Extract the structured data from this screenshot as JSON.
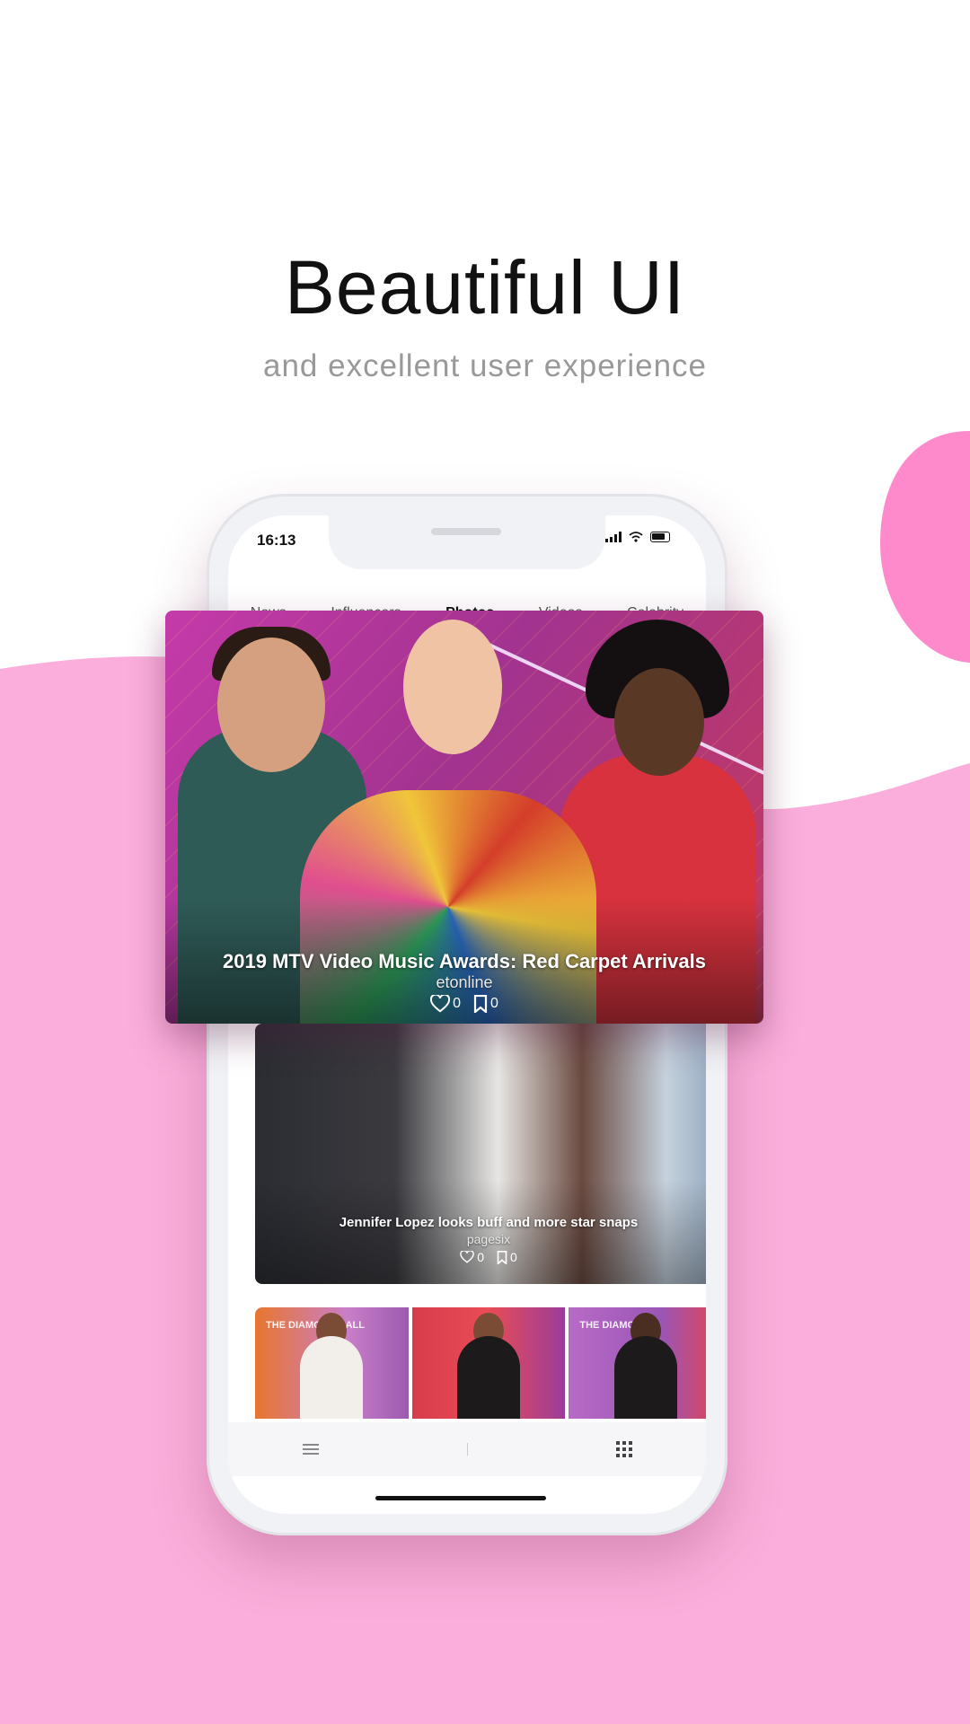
{
  "headline": "Beautiful UI",
  "subline": "and excellent user experience",
  "status": {
    "time": "16:13"
  },
  "tabs": [
    {
      "label": "News",
      "active": false
    },
    {
      "label": "Influencers",
      "active": false
    },
    {
      "label": "Photos",
      "active": true
    },
    {
      "label": "Videos",
      "active": false
    },
    {
      "label": "Celebrity",
      "active": false
    }
  ],
  "hero_card": {
    "title": "2019 MTV Video Music Awards: Red Carpet Arrivals",
    "source": "etonline",
    "likes": "0",
    "bookmarks": "0"
  },
  "second_card": {
    "title": "Jennifer Lopez looks buff and more star snaps",
    "source": "pagesix",
    "likes": "0",
    "bookmarks": "0"
  },
  "thumbnails": [
    {
      "label": "THE DIAMOND BALL"
    },
    {
      "label": ""
    },
    {
      "label": "THE DIAMOND"
    }
  ],
  "colors": {
    "accent": "#ff5fa8",
    "background_pink": "#fbaedb",
    "circle_pink": "#ff8acb"
  },
  "icons": {
    "menu": "menu-icon",
    "grid": "grid-icon",
    "heart": "heart-icon",
    "bookmark": "bookmark-icon"
  }
}
